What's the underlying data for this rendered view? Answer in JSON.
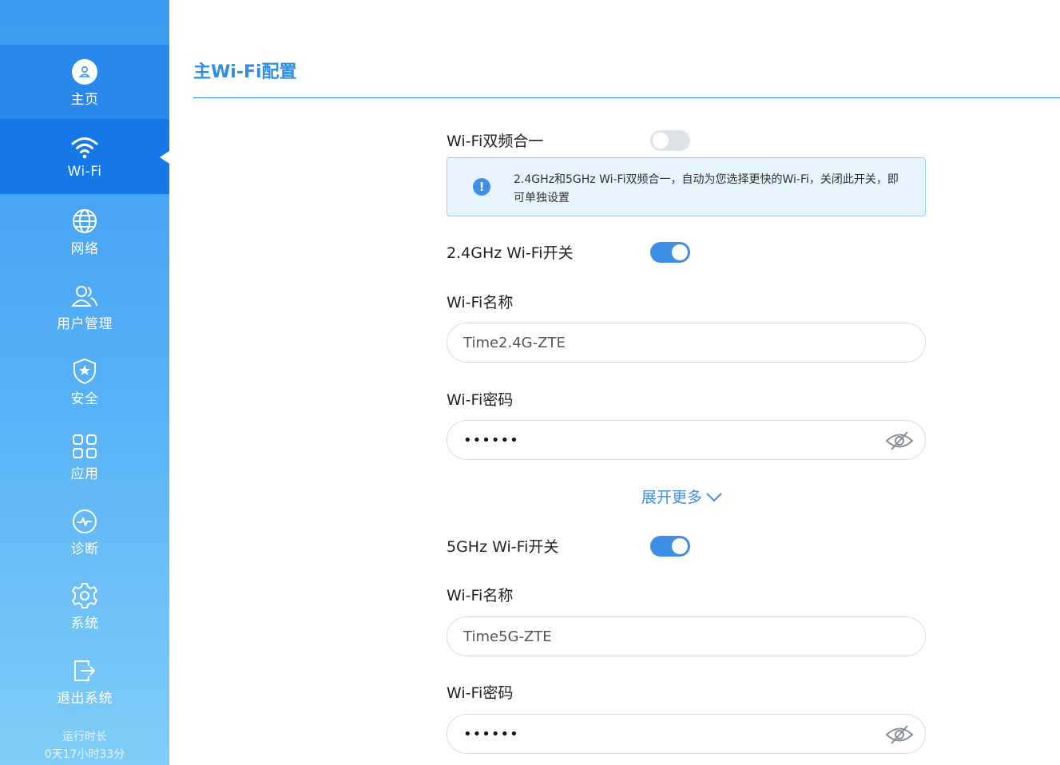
{
  "sidebar": {
    "items": [
      {
        "label": "主页",
        "icon": "home-user-icon"
      },
      {
        "label": "Wi-Fi",
        "icon": "wifi-icon"
      },
      {
        "label": "网络",
        "icon": "globe-icon"
      },
      {
        "label": "用户管理",
        "icon": "users-icon"
      },
      {
        "label": "安全",
        "icon": "shield-star-icon"
      },
      {
        "label": "应用",
        "icon": "apps-grid-icon"
      },
      {
        "label": "诊断",
        "icon": "pulse-icon"
      },
      {
        "label": "系统",
        "icon": "gear-icon"
      },
      {
        "label": "退出系统",
        "icon": "logout-icon"
      }
    ],
    "active_index": 1,
    "uptime_label": "运行时长",
    "uptime_value": "0天17小时33分"
  },
  "main": {
    "title": "主Wi-Fi配置",
    "dual_band": {
      "label": "Wi-Fi双频合一",
      "enabled": false
    },
    "info": {
      "text": "2.4GHz和5GHz Wi-Fi双频合一，自动为您选择更快的Wi-Fi，关闭此开关，即可单独设置"
    },
    "band_24": {
      "switch_label": "2.4GHz Wi-Fi开关",
      "enabled": true,
      "name_label": "Wi-Fi名称",
      "name_value": "Time2.4G-ZTE",
      "password_label": "Wi-Fi密码",
      "password_value": "••••••"
    },
    "expand_label": "展开更多",
    "band_5": {
      "switch_label": "5GHz Wi-Fi开关",
      "enabled": true,
      "name_label": "Wi-Fi名称",
      "name_value": "Time5G-ZTE",
      "password_label": "Wi-Fi密码",
      "password_value": "••••••"
    }
  },
  "colors": {
    "accent": "#3f8ee6",
    "active_nav": "#1677e6",
    "info_bg": "#e6f4fd"
  }
}
